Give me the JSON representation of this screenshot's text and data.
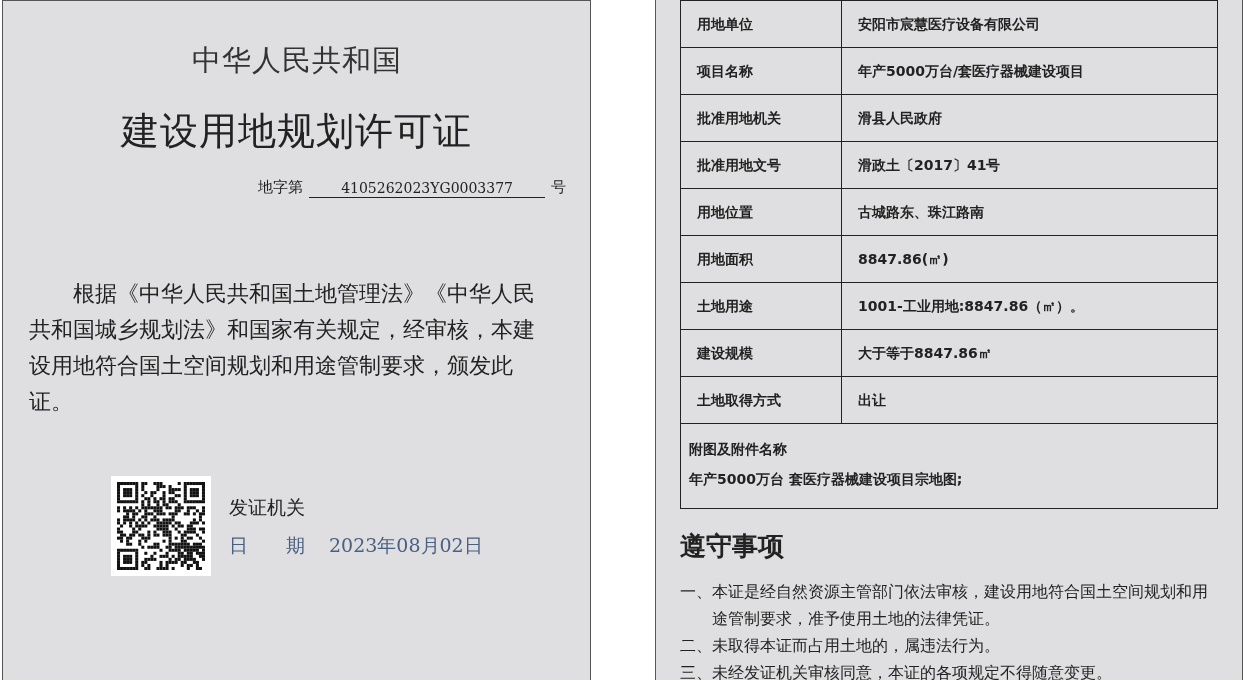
{
  "certificate": {
    "country": "中华人民共和国",
    "title": "建设用地规划许可证",
    "number_prefix": "地字第",
    "number": "4105262023YG0003377",
    "number_suffix": "号",
    "statement": "根据《中华人民共和国土地管理法》《中华人民共和国城乡规划法》和国家有关规定，经审核，本建设用地符合国土空间规划和用途管制要求，颁发此证。",
    "issuer_label": "发证机关",
    "date_label": "日　　期",
    "date": "2023年08月02日"
  },
  "details": {
    "rows": [
      {
        "label": "用地单位",
        "value": "安阳市宸慧医疗设备有限公司"
      },
      {
        "label": "项目名称",
        "value": "年产5000万台/套医疗器械建设项目"
      },
      {
        "label": "批准用地机关",
        "value": "滑县人民政府"
      },
      {
        "label": "批准用地文号",
        "value": "滑政土〔2017〕41号"
      },
      {
        "label": "用地位置",
        "value": "古城路东、珠江路南"
      },
      {
        "label": "用地面积",
        "value": "8847.86(㎡)"
      },
      {
        "label": "土地用途",
        "value": "1001-工业用地:8847.86（㎡）。"
      },
      {
        "label": "建设规模",
        "value": "大于等于8847.86㎡"
      },
      {
        "label": "土地取得方式",
        "value": "出让"
      }
    ],
    "attachments_label": "附图及附件名称",
    "attachments": "年产5000万台 套医疗器械建设项目宗地图;"
  },
  "notes": {
    "title": "遵守事项",
    "items": [
      "一、本证是经自然资源主管部门依法审核，建设用地符合国土空间规划和用途管制要求，准予使用土地的法律凭证。",
      "二、未取得本证而占用土地的，属违法行为。",
      "三、未经发证机关审核同意，本证的各项规定不得随意变更。"
    ]
  }
}
